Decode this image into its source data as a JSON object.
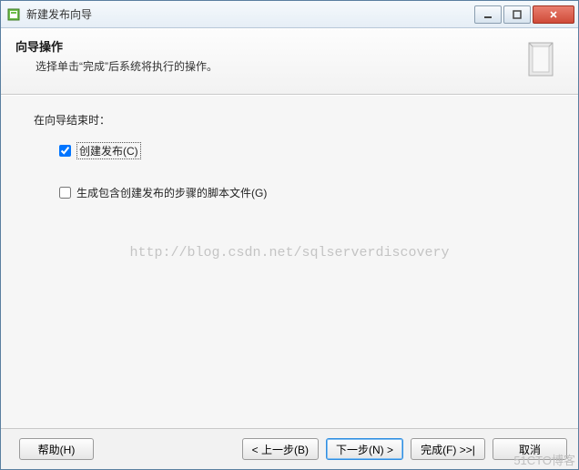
{
  "window": {
    "title": "新建发布向导"
  },
  "header": {
    "title": "向导操作",
    "subtitle": "选择单击“完成”后系统将执行的操作。"
  },
  "content": {
    "prompt": "在向导结束时：",
    "option_create": {
      "label": "创建发布(C)",
      "checked": true
    },
    "option_script": {
      "label": "生成包含创建发布的步骤的脚本文件(G)",
      "checked": false
    }
  },
  "watermark": "http://blog.csdn.net/sqlserverdiscovery",
  "corner_watermark": "51CTO博客",
  "footer": {
    "help": "帮助(H)",
    "back": "< 上一步(B)",
    "next": "下一步(N) >",
    "finish": "完成(F) >>|",
    "cancel": "取消"
  }
}
